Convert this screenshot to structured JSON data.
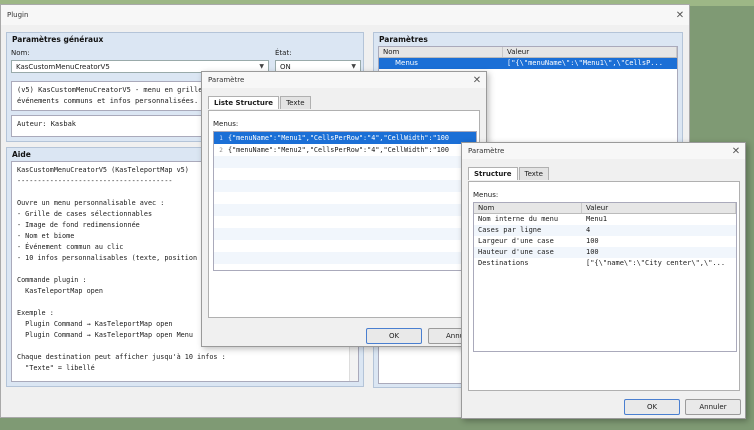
{
  "main": {
    "title": "Plugin",
    "general": {
      "title": "Paramètres généraux",
      "name_label": "Nom:",
      "name_value": "KasCustomMenuCreatorV5",
      "state_label": "État:",
      "state_value": "ON",
      "desc_lines": [
        "(v5) KasCustomMenuCreatorV5 - menu en grille",
        "événements communs et infos personnalisées."
      ],
      "author": "Auteur: Kasbak"
    },
    "params": {
      "title": "Paramètres",
      "col_name": "Nom",
      "col_value": "Valeur",
      "rows": [
        {
          "name": "Menus",
          "value": "[\"{\\\"menuName\\\":\\\"Menu1\\\",\\\"CellsP..."
        }
      ]
    },
    "help": {
      "title": "Aide",
      "lines": [
        "KasCustomMenuCreatorV5 (KasTeleportMap v5)",
        "--------------------------------------",
        "",
        "Ouvre un menu personnalisable avec :",
        "- Grille de cases sélectionnables",
        "- Image de fond redimensionnée",
        "- Nom et biome",
        "- Événement commun au clic",
        "- 10 infos personnalisables (texte, position",
        "",
        "Commande plugin :",
        "  KasTeleportMap open",
        "",
        "Exemple :",
        "  Plugin Command → KasTeleportMap open",
        "  Plugin Command → KasTeleportMap open Menu",
        "",
        "Chaque destination peut afficher jusqu'à 10 infos :",
        "  \"Texte\" = libellé"
      ]
    }
  },
  "dlg1": {
    "title": "Paramètre",
    "tabs": [
      "Liste Structure",
      "Texte"
    ],
    "list_label": "Menus:",
    "items": [
      {
        "num": "1",
        "text": "{\"menuName\":\"Menu1\",\"CellsPerRow\":\"4\",\"CellWidth\":\"100"
      },
      {
        "num": "2",
        "text": "{\"menuName\":\"Menu2\",\"CellsPerRow\":\"4\",\"CellWidth\":\"100"
      }
    ],
    "ok": "OK",
    "cancel": "Annul"
  },
  "dlg2": {
    "title": "Paramètre",
    "tabs": [
      "Structure",
      "Texte"
    ],
    "group_label": "Menus:",
    "col_name": "Nom",
    "col_value": "Valeur",
    "rows": [
      {
        "name": "Nom interne du menu",
        "value": "Menu1"
      },
      {
        "name": "Cases par ligne",
        "value": "4"
      },
      {
        "name": "Largeur d'une case",
        "value": "100"
      },
      {
        "name": "Hauteur d'une case",
        "value": "100"
      },
      {
        "name": "Destinations",
        "value": "[\"{\\\"name\\\":\\\"City center\\\",\\\"..."
      }
    ],
    "ok": "OK",
    "cancel": "Annuler"
  }
}
